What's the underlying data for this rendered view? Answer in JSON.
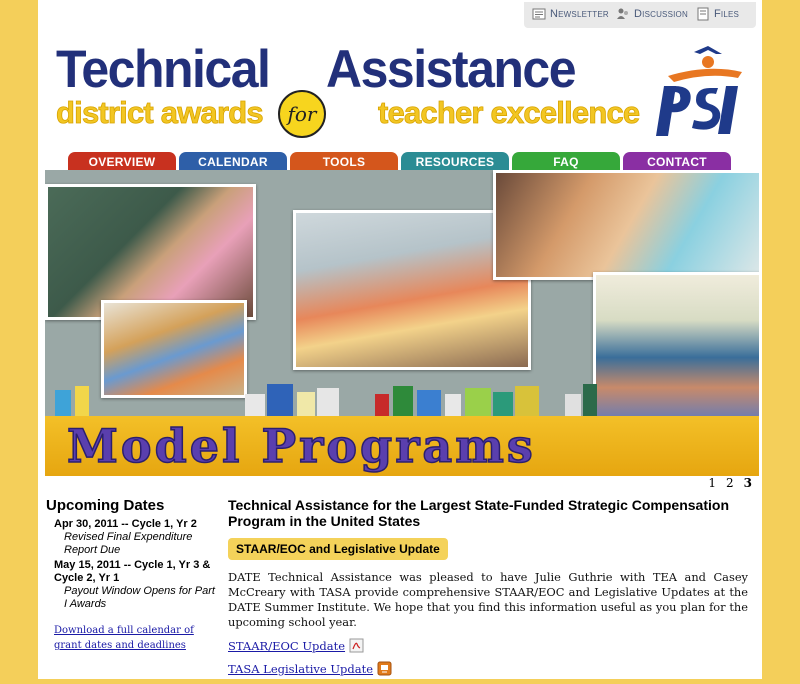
{
  "util": {
    "newsletter": "Newsletter",
    "discussion": "Discussion",
    "files": "Files"
  },
  "header": {
    "title_left": "Technical",
    "title_right": "Assistance",
    "sub_left": "district awards",
    "for_badge": "for",
    "sub_right": "teacher excellence"
  },
  "nav": [
    {
      "label": "OVERVIEW",
      "color": "#c8311f"
    },
    {
      "label": "CALENDAR",
      "color": "#2e5fa8"
    },
    {
      "label": "TOOLS",
      "color": "#d4561c"
    },
    {
      "label": "RESOURCES",
      "color": "#2b8c94"
    },
    {
      "label": "FAQ",
      "color": "#36a83a"
    },
    {
      "label": "CONTACT",
      "color": "#8a2fa3"
    }
  ],
  "banner": {
    "headline": "Model Programs"
  },
  "pager": [
    "1",
    "2",
    "3"
  ],
  "upcoming": {
    "heading": "Upcoming Dates",
    "events": [
      {
        "date": "Apr 30, 2011 -- Cycle 1, Yr 2",
        "desc": "Revised Final Expenditure Report Due"
      },
      {
        "date": "May 15, 2011 -- Cycle 1, Yr 3 & Cycle 2, Yr 1",
        "desc": "Payout Window Opens for Part I Awards"
      }
    ],
    "calendar_link": "Download a full calendar of grant dates and deadlines"
  },
  "main": {
    "heading": "Technical Assistance for the Largest State-Funded Strategic Compensation Program in the United States",
    "button": "STAAR/EOC and Legislative Update",
    "paragraph": "DATE Technical Assistance was pleased to have Julie Guthrie with TEA and Casey McCreary with TASA provide comprehensive STAAR/EOC and Legislative Updates at the DATE Summer Institute. We hope that you find this information useful as you plan for the upcoming school year.",
    "links": [
      {
        "label": "STAAR/EOC Update",
        "icon": "pdf-icon"
      },
      {
        "label": "TASA Legislative Update",
        "icon": "powerpoint-icon"
      }
    ]
  },
  "colors": {
    "page_bg": "#f4cf5a",
    "title_blue": "#22307a",
    "subtitle_gold": "#f2c623",
    "banner_headline": "#5a3fae"
  }
}
